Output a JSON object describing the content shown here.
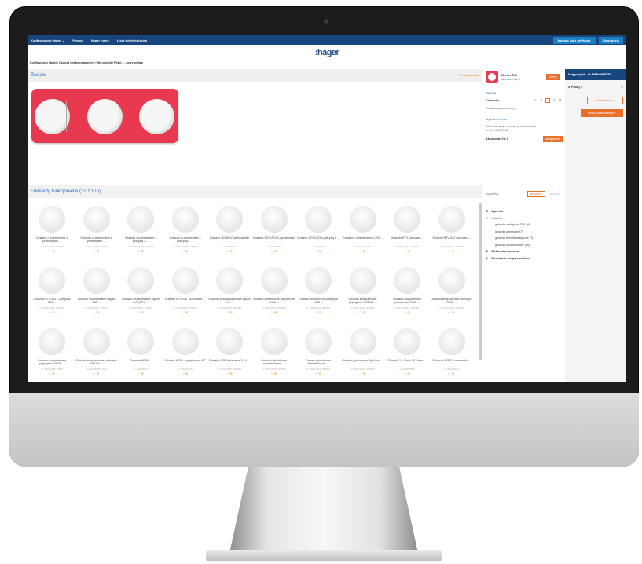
{
  "nav": {
    "items": [
      "Konfiguratory Hager ⌄",
      "Pomoc",
      "Hager home",
      "Lista dystrybutorów"
    ],
    "login_hager": "Zaloguj się z myHager ›",
    "login": "Zaloguj się"
  },
  "logo": ":hager",
  "breadcrumb": "Konfiguratory Hager / Osprzęt elektroinstalacyjny / Mój projekt / Pokój 1 - nowy zestaw",
  "set": {
    "title": "Zestaw",
    "reset_link": "Zresetuj zestaw"
  },
  "section": {
    "title": "Elementy funkcjonalne (32 z 175)"
  },
  "products": [
    {
      "name": "Gniazdo z uziemieniem z przesłonami ...",
      "ref": "nr: WGC216X, 25039X"
    },
    {
      "name": "Gniazdo z uziemieniem z przesłonami ...",
      "ref": "nr: WGC216X, 25039X"
    },
    {
      "name": "Gniazdo z uziemieniem z pokrywą z ...",
      "ref": "nr: WGS21620X, 25039X"
    },
    {
      "name": "Gniazdo z uziemieniem z pokrywą z ...",
      "ref": "nr: WGS21620X, 25039X"
    },
    {
      "name": "Gniazdo SCHUKO samozaciski ...",
      "ref": "nr: 07/57390"
    },
    {
      "name": "Gniazdo SCHUKO z przesłonami ...",
      "ref": "nr: 07/57390"
    },
    {
      "name": "Gniazdo SCHUKO z pokrywą z ...",
      "ref": "nr: 07/57390"
    },
    {
      "name": "Gniazdo z uziemieniem i LED ...",
      "ref": "nr: WGS21620X"
    },
    {
      "name": "Gniazdo RTV końcowe ...",
      "ref": "nr: WGC238X, 25039X"
    },
    {
      "name": "Gniazdo RTV-SAT końcowe ...",
      "ref": "nr: WGC239X, 25039X"
    },
    {
      "name": "Gniazdo RTV-SAT - 2 wyjścia SAT ...",
      "ref": "nr: WGC248X, 25039X"
    },
    {
      "name": "Gniazdo multimedialne złącze SAT ...",
      "ref": "nr: WGC249X, 25039X"
    },
    {
      "name": "Gniazdo multimedialne złącze 3xF (SPC ...",
      "ref": "nr: WGC250X, 25039X"
    },
    {
      "name": "Gniazdo RTV-SAT przelotowe ...",
      "ref": "nr: WGC251X, 25039X"
    },
    {
      "name": "Gniazdo szerokopasmowe złącze 2xF ...",
      "ref": "nr: WGC252X, 25039X"
    },
    {
      "name": "Gniazdo telefoniczne pojedyncze RJ45 ...",
      "ref": "nr: WGC260X, 25039X"
    },
    {
      "name": "Gniazdo telefoniczne podwójne RJ45 ...",
      "ref": "nr: WGC261X, 25039X"
    },
    {
      "name": "Gniazdo komputerowe pojedyncze 2xRJ45 ...",
      "ref": "nr: WGC262X, 25039X"
    },
    {
      "name": "Gniazdo komputerowe pojedyncze RJ45 ...",
      "ref": "nr: WGC263X, 25039X"
    },
    {
      "name": "Gniazdo komputerowe podwójne RJ45 ...",
      "ref": "nr: WGC264X, 25039X"
    },
    {
      "name": "Gniazdo komputerowe pojedyncze RJ45 ...",
      "ref": "nr: WGC265X, 1058"
    },
    {
      "name": "Gniazdo komputerowe podwójne 2xRJ45 ...",
      "ref": "nr: WGC266X, 1037"
    },
    {
      "name": "Gniazdo HDMI ...",
      "ref": "nr: WGC270X"
    },
    {
      "name": "Gniazdo HDMI z przyłączem 90° ...",
      "ref": "nr: WGC271X"
    },
    {
      "name": "Gniazdo USB ładowarka 2.0 A ...",
      "ref": "nr: WGC280X, 25039X"
    },
    {
      "name": "Gniazdo głośnikowe stereofoniczne ...",
      "ref": "nr: WGC290X, 25039X"
    },
    {
      "name": "Gniazdo głośnikowe stereofoniczne ...",
      "ref": "nr: WGC291X, 25039X"
    },
    {
      "name": "Gniazdo głośnikowe High End ...",
      "ref": "nr: WGC292X, 25039X"
    },
    {
      "name": "Gniazdo 3 x Cinch / S-Video ...",
      "ref": "nr: WGC293X"
    },
    {
      "name": "Gniazdo USB/3,5 mm audio ...",
      "ref": "nr: WGC294X"
    },
    {
      "name": "",
      "ref": ""
    },
    {
      "name": "",
      "ref": ""
    }
  ],
  "filters": {
    "label": "wyświetlaj:",
    "active": "wszystkie",
    "inactive": "wybrane",
    "tree": [
      {
        "label": "Łączniki",
        "level": 1,
        "icon": "☐"
      },
      {
        "label": "Gniazda",
        "level": "1a",
        "icon": "☐"
      },
      {
        "label": "gniazda zasilające 230V (8)",
        "level": 2
      },
      {
        "label": "gniazda antenowe (7)",
        "level": 2
      },
      {
        "label": "gniazda teleinformatyczne (7)",
        "level": 2
      },
      {
        "label": "gniazda multimedialne (10)",
        "level": 2
      },
      {
        "label": "Elektronika domowa",
        "level": 1,
        "icon": "⚙"
      },
      {
        "label": "Sterowanie bezprzewodowe",
        "level": 1,
        "icon": "⊘"
      }
    ]
  },
  "selected": {
    "name": "Berker R.1",
    "subtitle": "czerwony, akryl",
    "change": "Zmień",
    "frame_title": "Ramka",
    "count_label": "Krotność:",
    "counts": [
      "1",
      "2",
      "3",
      "4",
      "5"
    ],
    "selected_count": "3",
    "extra": "Dodatkowe parametry",
    "chosen_label": "Wybrana ramka",
    "description": "3-krotna, akryl, czerwony, uniwersalna",
    "ref": "nr ref.: 10139162",
    "accessories": "Akcesoria: 0 x 0",
    "add_button": "dostępność"
  },
  "project": {
    "header": "Mój projekt - id: RMWWRFZN",
    "room": "A  Pokój 1",
    "add_set": "dodaj zestaw +",
    "add_room": "dodaj pomieszczenie +"
  }
}
